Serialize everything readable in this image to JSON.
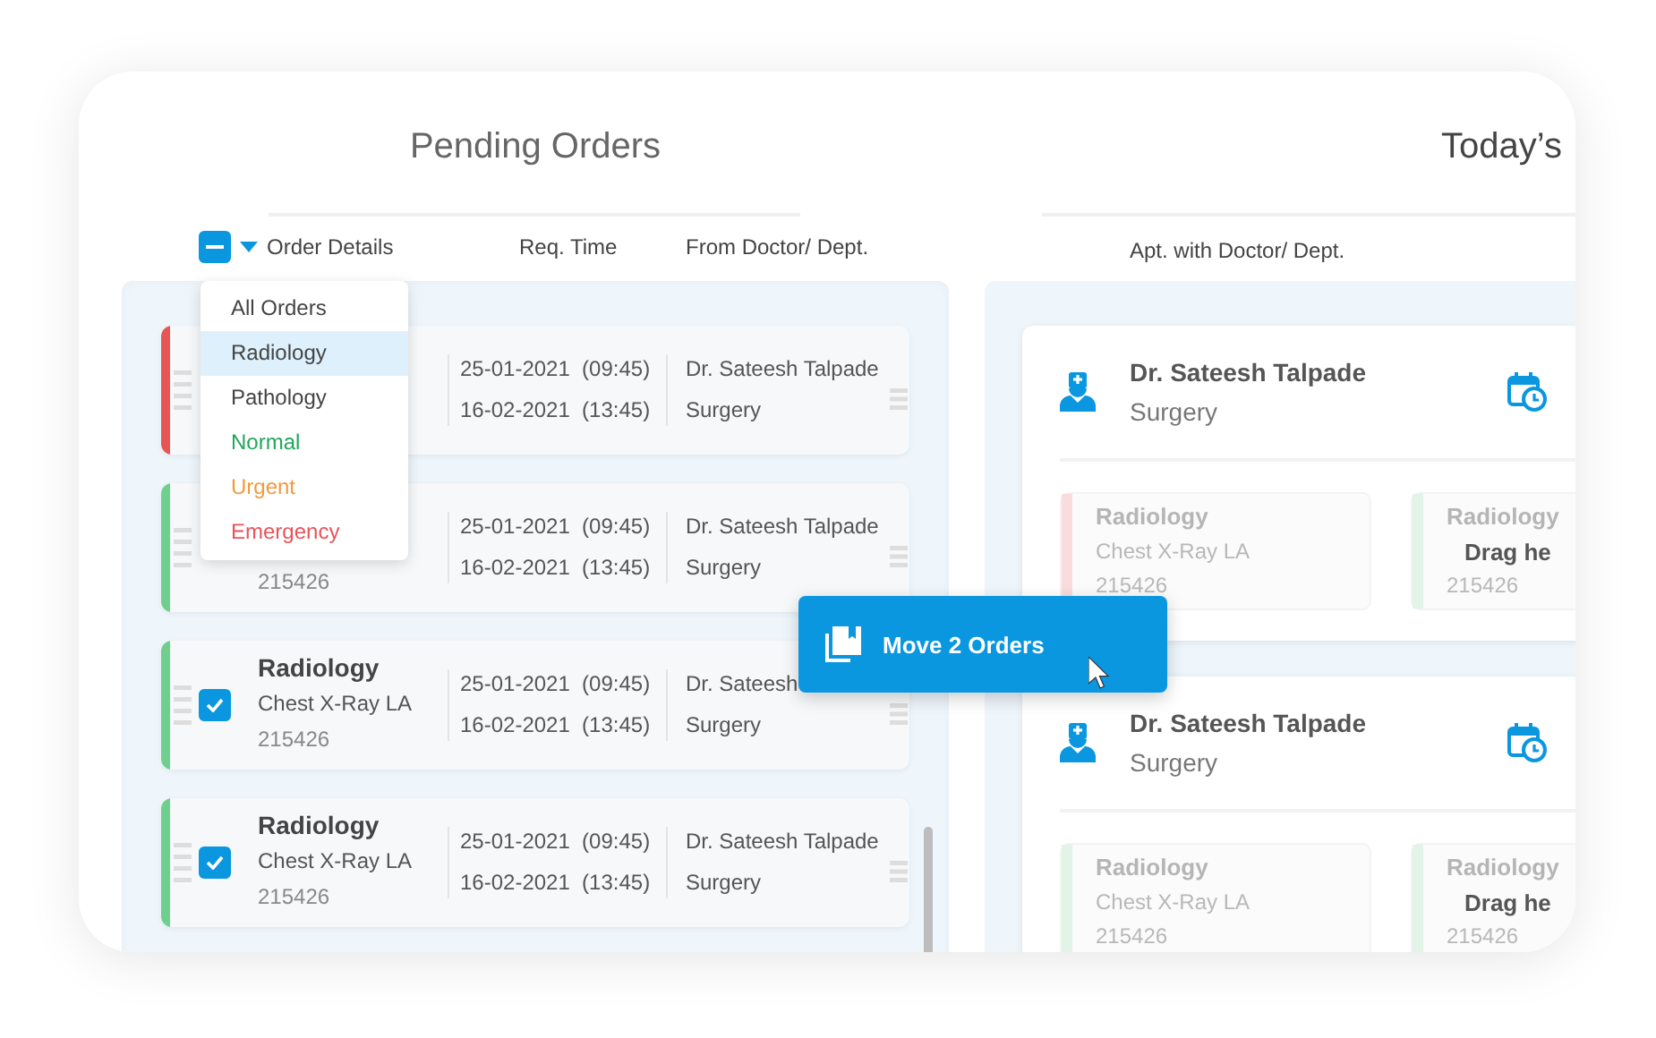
{
  "pending": {
    "title": "Pending Orders",
    "select_all": {
      "indeterminate": true
    },
    "columns": [
      "Order Details",
      "Req. Time",
      "From Doctor/ Dept."
    ],
    "filter_menu": {
      "expanded": true,
      "items": [
        {
          "label": "All Orders",
          "selected": false,
          "color": "#444444"
        },
        {
          "label": "Radiology",
          "selected": true,
          "color": "#444444"
        },
        {
          "label": "Pathology",
          "selected": false,
          "color": "#444444"
        },
        {
          "label": "Normal",
          "selected": false,
          "color": "#22a85a"
        },
        {
          "label": "Urgent",
          "selected": false,
          "color": "#f39a3c"
        },
        {
          "label": "Emergency",
          "selected": false,
          "color": "#e8545a"
        }
      ]
    },
    "orders": [
      {
        "color": "#e85555",
        "dates": [
          "25-01-2021  (09:45)",
          "16-02-2021  (13:45)"
        ],
        "doctor": "Dr. Sateesh Talpade",
        "dept": "Surgery"
      },
      {
        "color": "#6fcf8f",
        "id": "215426",
        "dates": [
          "25-01-2021  (09:45)",
          "16-02-2021  (13:45)"
        ],
        "doctor": "Dr. Sateesh Talpade",
        "dept": "Surgery"
      },
      {
        "color": "#6fcf8f",
        "checked": true,
        "title": "Radiology",
        "test": "Chest X-Ray LA",
        "id": "215426",
        "dates": [
          "25-01-2021  (09:45)",
          "16-02-2021  (13:45)"
        ],
        "doctor": "Dr. Sateesh",
        "dept": "Surgery"
      },
      {
        "color": "#6fcf8f",
        "checked": true,
        "title": "Radiology",
        "test": "Chest X-Ray LA",
        "id": "215426",
        "dates": [
          "25-01-2021  (09:45)",
          "16-02-2021  (13:45)"
        ],
        "doctor": "Dr. Sateesh Talpade",
        "dept": "Surgery"
      }
    ]
  },
  "move_button": {
    "label": "Move 2 Orders"
  },
  "appointments": {
    "title": "Today’s",
    "columns": [
      "Apt. with Doctor/ Dept."
    ],
    "cards": [
      {
        "doctor": "Dr. Sateesh Talpade",
        "dept": "Surgery",
        "slots": [
          {
            "color": "#fbdcdc",
            "title": "Radiology",
            "test": "Chest X-Ray LA",
            "id": "215426"
          },
          {
            "color": "#e2f4e8",
            "title": "Radiology",
            "drop_hint": "Drag he",
            "id": "215426"
          }
        ]
      },
      {
        "doctor": "Dr. Sateesh Talpade",
        "dept": "Surgery",
        "slots": [
          {
            "color": "#e2f4e8",
            "title": "Radiology",
            "test": "Chest X-Ray LA",
            "id": "215426"
          },
          {
            "color": "#e2f4e8",
            "title": "Radiology",
            "drop_hint": "Drag he",
            "id": "215426"
          }
        ]
      }
    ]
  }
}
